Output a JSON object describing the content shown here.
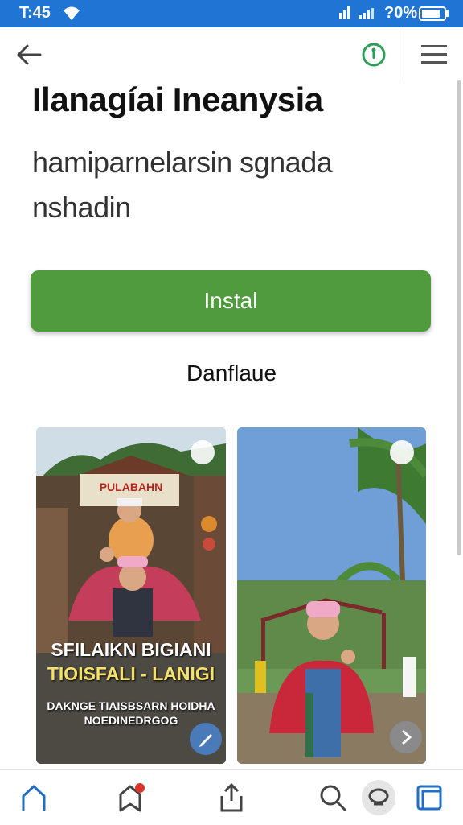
{
  "status_bar": {
    "time": "T:45",
    "battery_text": "?0%",
    "icons": [
      "wifi-icon",
      "signal-icon",
      "battery-icon"
    ]
  },
  "top_bar": {
    "back_icon": "back-arrow-icon",
    "badge_icon": "info-circle-icon",
    "menu_icon": "hamburger-menu-icon"
  },
  "app": {
    "title": "Ilanagíai Ineanysia",
    "subtitle": "hamiparnelarsin sgnada nshadin",
    "install_label": "Instal",
    "secondary_link": "Danflaue"
  },
  "screenshots": [
    {
      "banner": "PULABAHN",
      "caption_line1": "SFILAIKN BIGIANI",
      "caption_line2": "TIOISFALI - LANIGI",
      "caption_line3": "DAKNGE TIAISBSARN HOIDHA",
      "caption_line4": "NOEDINEDRGOG",
      "action_icon": "edit-icon"
    },
    {
      "action_icon": "chevron-right-icon"
    }
  ],
  "bottom_nav": [
    "home-icon",
    "bookmark-icon",
    "share-icon",
    "search-icon",
    "chat-icon",
    "tabs-icon"
  ],
  "colors": {
    "status_bar": "#1f74d4",
    "install_button": "#519b3f",
    "accent_green": "#2e9e57",
    "nav_blue": "#1f6fc4"
  }
}
